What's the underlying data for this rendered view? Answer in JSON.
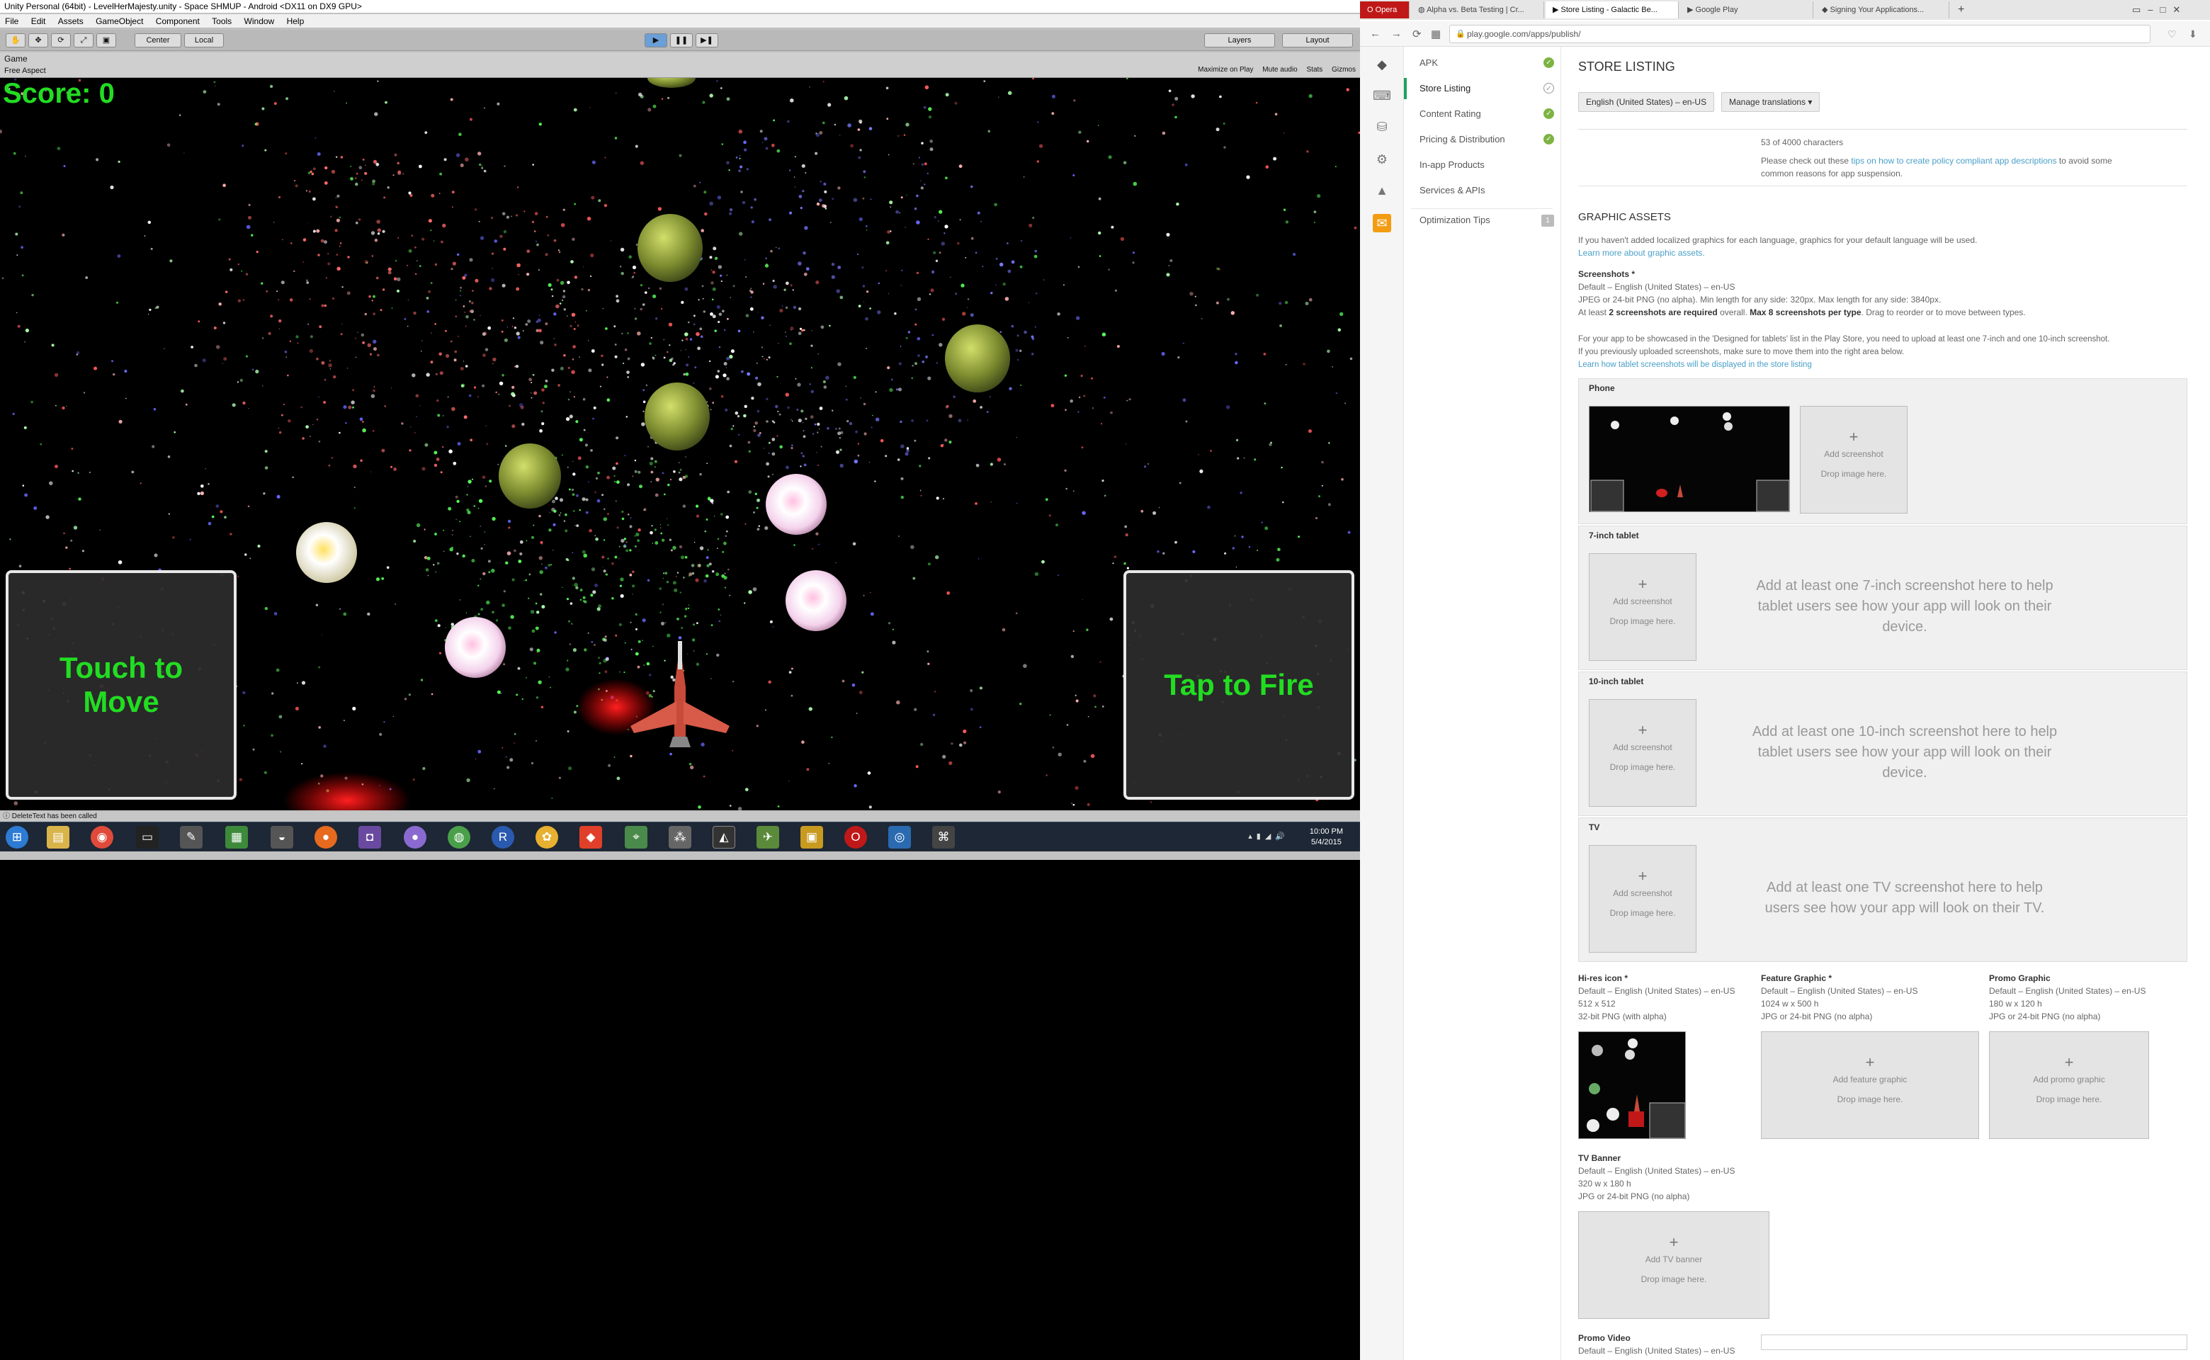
{
  "unity": {
    "title": "Unity Personal (64bit) - LevelHerMajesty.unity - Space SHMUP - Android <DX11 on DX9 GPU>",
    "menu": [
      "File",
      "Edit",
      "Assets",
      "GameObject",
      "Component",
      "Tools",
      "Window",
      "Help"
    ],
    "toolbar": {
      "center": "Center",
      "local": "Local",
      "layers": "Layers",
      "layout": "Layout"
    },
    "game_tab": "Game",
    "aspect": "Free Aspect",
    "game_options": [
      "Maximize on Play",
      "Mute audio",
      "Stats",
      "Gizmos"
    ],
    "score": "Score: 0",
    "touch_to_move": "Touch to\nMove",
    "tap_to_fire": "Tap to Fire",
    "status": "DeleteText has been called"
  },
  "taskbar": {
    "time": "10:00 PM",
    "date": "5/4/2015"
  },
  "browser": {
    "tabs": [
      {
        "label": "Opera",
        "icon": "opera-icon"
      },
      {
        "label": "Alpha vs. Beta Testing | Cr...",
        "icon": "page-icon"
      },
      {
        "label": "Store Listing - Galactic Be...",
        "icon": "play-icon"
      },
      {
        "label": "Google Play",
        "icon": "play-icon"
      },
      {
        "label": "Signing Your Applications...",
        "icon": "android-icon"
      }
    ],
    "url": "play.google.com/apps/publish/",
    "sidebar": [
      {
        "label": "APK",
        "status": "done"
      },
      {
        "label": "Store Listing",
        "status": "pending"
      },
      {
        "label": "Content Rating",
        "status": "done"
      },
      {
        "label": "Pricing & Distribution",
        "status": "done"
      },
      {
        "label": "In-app Products",
        "status": ""
      },
      {
        "label": "Services & APIs",
        "status": ""
      },
      {
        "label": "Optimization Tips",
        "status": "1"
      }
    ],
    "main": {
      "heading": "STORE LISTING",
      "language_button": "English (United States) – en-US",
      "manage_translations": "Manage translations ▾",
      "char_count": "53 of 4000 characters",
      "policy_pre": "Please check out these ",
      "policy_link": "tips on how to create policy compliant app descriptions",
      "policy_post": " to avoid some",
      "policy_line2": "common reasons for app suspension.",
      "graphic_assets": "GRAPHIC ASSETS",
      "ga_intro": "If you haven't added localized graphics for each language, graphics for your default language will be used.",
      "ga_learn": "Learn more about graphic assets.",
      "screenshots_title": "Screenshots *",
      "screenshots_default": "Default – English (United States) – en-US",
      "screenshots_format": "JPEG or 24-bit PNG (no alpha). Min length for any side: 320px. Max length for any side: 3840px.",
      "screenshots_req_a": "At least ",
      "screenshots_req_b": "2 screenshots are required",
      "screenshots_req_c": " overall. ",
      "screenshots_req_d": "Max 8 screenshots per type",
      "screenshots_req_e": ". Drag to reorder or to move between types.",
      "tablet_note_1": "For your app to be showcased in the 'Designed for tablets' list in the Play Store, you need to upload at least one 7-inch and one 10-inch screenshot.",
      "tablet_note_2": "If you previously uploaded screenshots, make sure to move them into the right area below.",
      "tablet_link": "Learn how tablet screenshots will be displayed in the store listing",
      "add_screenshot": "Add screenshot",
      "drop_image": "Drop image here.",
      "phone": "Phone",
      "tablet7": "7-inch tablet",
      "tablet7_hint": "Add at least one 7-inch screenshot here to help tablet users see how your app will look on their device.",
      "tablet10": "10-inch tablet",
      "tablet10_hint": "Add at least one 10-inch screenshot here to help tablet users see how your app will look on their device.",
      "tv": "TV",
      "tv_hint": "Add at least one TV screenshot here to help users see how your app will look on their TV.",
      "hires_title": "Hi-res icon *",
      "hires_default": "Default – English (United States) – en-US",
      "hires_size": "512 x 512",
      "hires_format": "32-bit PNG (with alpha)",
      "feature_title": "Feature Graphic *",
      "feature_default": "Default – English (United States) – en-US",
      "feature_size": "1024 w x 500 h",
      "feature_format": "JPG or 24-bit PNG (no alpha)",
      "feature_add": "Add feature graphic",
      "promo_title": "Promo Graphic",
      "promo_default": "Default – English (United States) – en-US",
      "promo_size": "180 w x 120 h",
      "promo_format": "JPG or 24-bit PNG (no alpha)",
      "promo_add": "Add promo graphic",
      "tvbanner_title": "TV Banner",
      "tvbanner_default": "Default – English (United States) – en-US",
      "tvbanner_size": "320 w x 180 h",
      "tvbanner_format": "JPG or 24-bit PNG (no alpha)",
      "tvbanner_add": "Add TV banner",
      "promo_video_title": "Promo Video",
      "promo_video_default": "Default – English (United States) – en-US"
    }
  }
}
